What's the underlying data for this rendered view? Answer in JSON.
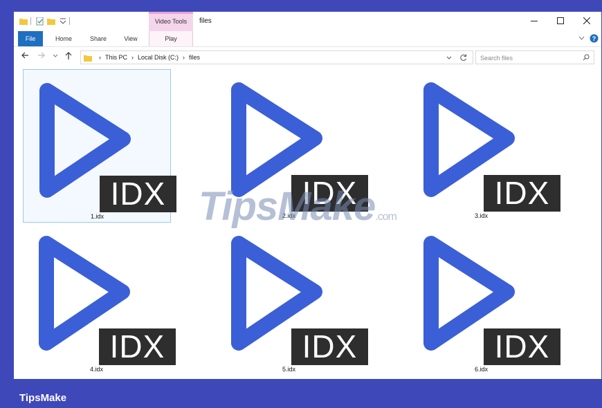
{
  "window": {
    "title": "files",
    "context_tab_group": "Video Tools"
  },
  "ribbon": {
    "tabs": [
      "File",
      "Home",
      "Share",
      "View",
      "Play"
    ]
  },
  "address": {
    "crumbs": [
      "This PC",
      "Local Disk (C:)",
      "files"
    ]
  },
  "search": {
    "placeholder": "Search files"
  },
  "files": [
    {
      "name": "1.idx",
      "badge": "IDX"
    },
    {
      "name": "2.idx",
      "badge": "IDX"
    },
    {
      "name": "3.idx",
      "badge": "IDX"
    },
    {
      "name": "4.idx",
      "badge": "IDX"
    },
    {
      "name": "5.idx",
      "badge": "IDX"
    },
    {
      "name": "6.idx",
      "badge": "IDX"
    }
  ],
  "watermark": {
    "text": "TipsMake",
    "suffix": ".com"
  },
  "brand": "TipsMake",
  "colors": {
    "background": "#3f48b8",
    "play_icon": "#3b5fd6",
    "file_tab": "#1e6fbf",
    "context_tab": "#f5d5ea"
  }
}
